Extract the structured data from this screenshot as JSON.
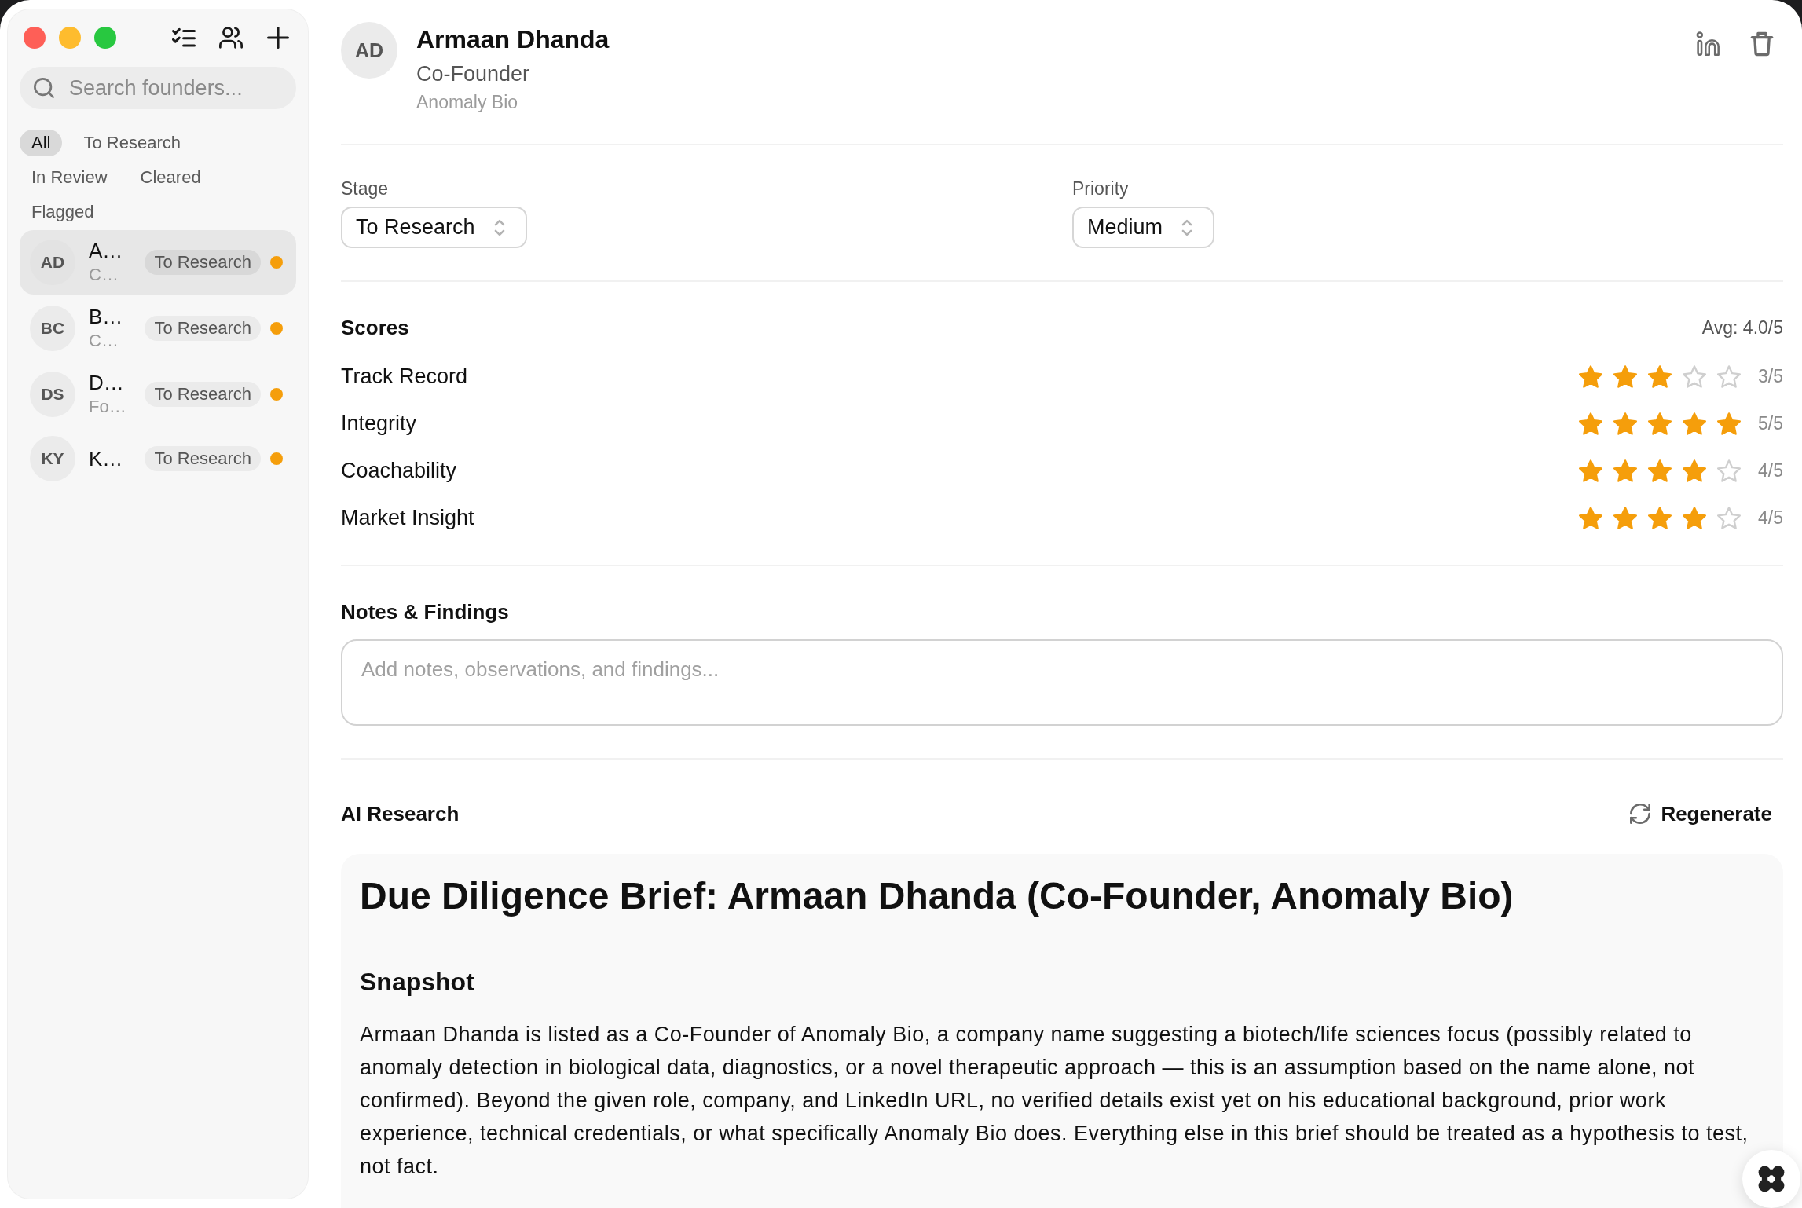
{
  "sidebar": {
    "search": {
      "placeholder": "Search founders..."
    },
    "filters": [
      {
        "label": "All",
        "selected": true
      },
      {
        "label": "To Research",
        "selected": false
      },
      {
        "label": "In Review",
        "selected": false
      },
      {
        "label": "Cleared",
        "selected": false
      },
      {
        "label": "Flagged",
        "selected": false
      }
    ],
    "founders": [
      {
        "initials": "AD",
        "name": "A…",
        "subtitle": "C…",
        "stage": "To Research",
        "color": "#f59e0b",
        "selected": true
      },
      {
        "initials": "BC",
        "name": "B…",
        "subtitle": "C…",
        "stage": "To Research",
        "color": "#f59e0b",
        "selected": false
      },
      {
        "initials": "DS",
        "name": "D…",
        "subtitle": "Fo…",
        "stage": "To Research",
        "color": "#f59e0b",
        "selected": false
      },
      {
        "initials": "KY",
        "name": "K…",
        "stage": "To Research",
        "color": "#f59e0b",
        "selected": false
      }
    ]
  },
  "profile": {
    "initials": "AD",
    "name": "Armaan Dhanda",
    "role": "Co-Founder",
    "company": "Anomaly Bio"
  },
  "fields": [
    {
      "label": "Stage",
      "value": "To Research"
    },
    {
      "label": "Priority",
      "value": "Medium"
    }
  ],
  "scores": {
    "title": "Scores",
    "average": "Avg: 4.0/5",
    "items": [
      {
        "label": "Track Record",
        "stars": 3,
        "reading": "3/5"
      },
      {
        "label": "Integrity",
        "stars": 5,
        "reading": "5/5"
      },
      {
        "label": "Coachability",
        "stars": 4,
        "reading": "4/5"
      },
      {
        "label": "Market Insight",
        "stars": 4,
        "reading": "4/5"
      }
    ]
  },
  "notes": {
    "title": "Notes & Findings",
    "placeholder": "Add notes, observations, and findings..."
  },
  "ai_research": {
    "title": "AI Research",
    "action": "Regenerate",
    "brief": {
      "title": "Due Diligence Brief: Armaan Dhanda (Co-Founder, Anomaly Bio)",
      "sections": [
        {
          "heading": "Snapshot",
          "text": "Armaan Dhanda is listed as a Co-Founder of Anomaly Bio, a company name suggesting a biotech/life sciences focus (possibly related to anomaly detection in biological data, diagnostics, or a novel therapeutic approach — this is an assumption based on the name alone, not confirmed). Beyond the given role, company, and LinkedIn URL, no verified details exist yet on his educational background, prior work experience, technical credentials, or what specifically Anomaly Bio does. Everything else in this brief should be treated as a hypothesis to test, not fact."
        }
      ]
    }
  }
}
